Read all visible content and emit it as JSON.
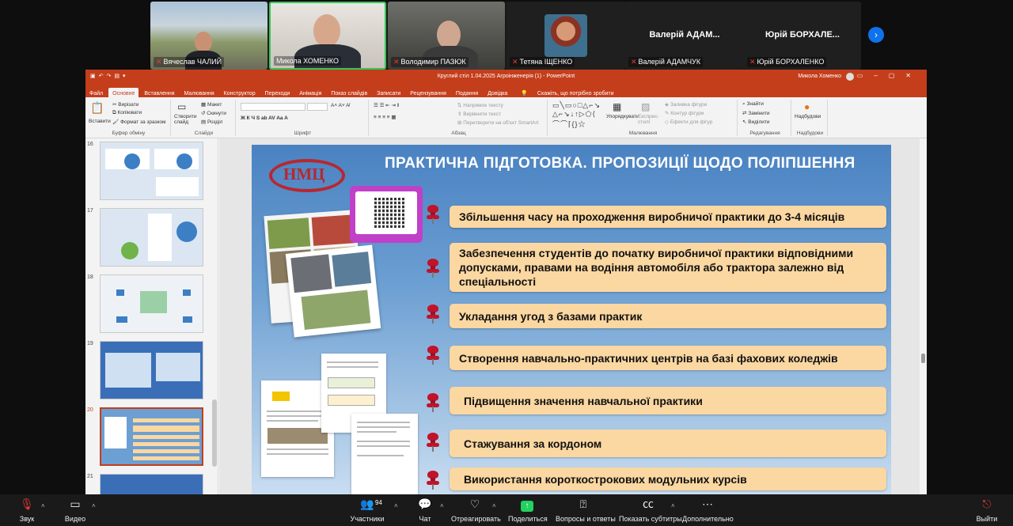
{
  "participants": [
    {
      "name": "Вячеслав ЧАЛИЙ"
    },
    {
      "name": "Микола ХОМЕНКО"
    },
    {
      "name": "Володимир ПАЗЮК"
    },
    {
      "name": "Тетяна ІЩЕНКО"
    },
    {
      "name": "Валерій АДАМЧУК",
      "display": "Валерій АДАМ..."
    },
    {
      "name": "Юрій БОРХАЛЕНКО",
      "display": "Юрій БОРХАЛЕ..."
    }
  ],
  "nav_icon": "chevron-right-icon",
  "ppt": {
    "title": "Круглий стіл 1.04.2025 Агроінженерія (1)  -  PowerPoint",
    "user": "Микола Хоменко",
    "user_initials": "МХ",
    "tabs": [
      "Файл",
      "Основне",
      "Вставлення",
      "Малювання",
      "Конструктор",
      "Переходи",
      "Анімація",
      "Показ слайдів",
      "Записати",
      "Рецензування",
      "Подання",
      "Довідка"
    ],
    "tell_me": "Скажіть, що потрібно зробити",
    "ribbon": {
      "paste": "Вставити",
      "cut": "Вирізати",
      "copy": "Копіювати",
      "format_painter": "Формат за зразком",
      "clipboard": "Буфер обміну",
      "new_slide": "Створити слайд",
      "layout": "Макет",
      "reset": "Скинути",
      "section": "Розділ",
      "slides": "Слайди",
      "font": "Шрифт",
      "text_direction": "Напрямок тексту",
      "align_text": "Вирівняти текст",
      "smartart": "Перетворити на об'єкт SmartArt",
      "paragraph": "Абзац",
      "arrange": "Упорядкувати",
      "quick_styles": "Експрес-стилі",
      "shape_fill": "Заливка фігури",
      "shape_outline": "Контур фігури",
      "shape_effects": "Ефекти для фігур",
      "drawing": "Малювання",
      "find": "Знайти",
      "replace": "Замінити",
      "select": "Виділити",
      "editing": "Редагування",
      "addins": "Надбудови",
      "addins_group": "Надбудови"
    },
    "thumbnails": [
      "16",
      "17",
      "18",
      "19",
      "20",
      "21"
    ],
    "selected_slide": "20"
  },
  "slide": {
    "title": "ПРАКТИЧНА ПІДГОТОВКА. ПРОПОЗИЦІЇ ЩОДО ПОЛІПШЕННЯ",
    "logo": "НМЦ",
    "items": [
      "Збільшення часу на проходження виробничої практики до 3-4 місяців",
      "Забезпечення студентів до початку виробничої практики відповідними допусками, правами на водіння автомобіля або трактора залежно від спеціальності",
      "Укладання угод з базами практик",
      "Створення навчально-практичних центрів на базі фахових коледжів",
      "Підвищення значення навчальної практики",
      "Стажування за кордоном",
      "Використання короткострокових модульних курсів"
    ]
  },
  "toolbar": {
    "audio": "Звук",
    "video": "Видео",
    "participants": "Участники",
    "participants_count": "94",
    "chat": "Чат",
    "react": "Отреагировать",
    "share": "Поделиться",
    "qa": "Вопросы и ответы",
    "captions": "Показать субтитры",
    "more": "Дополнительно",
    "leave": "Выйти"
  }
}
